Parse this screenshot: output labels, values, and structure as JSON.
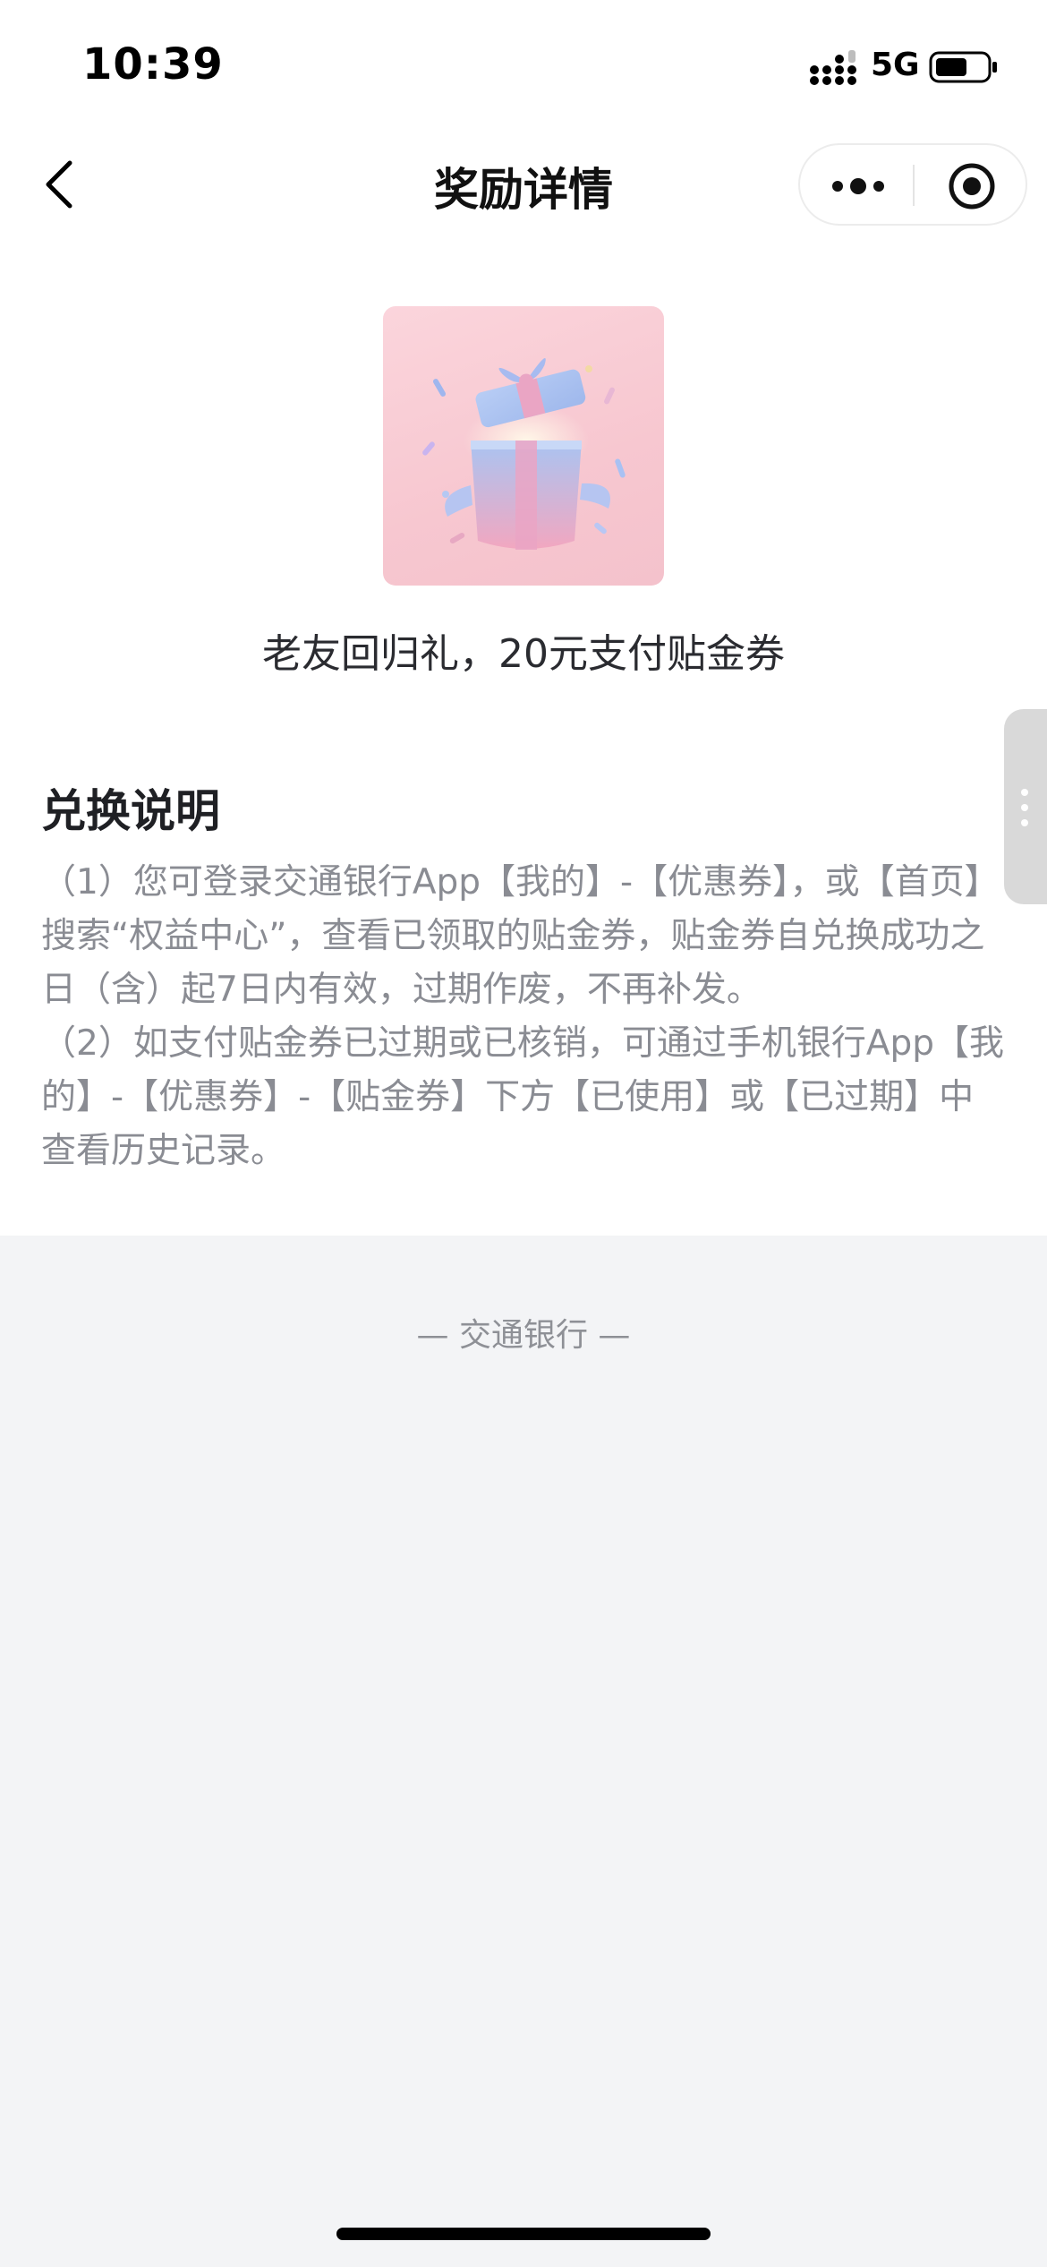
{
  "status_bar": {
    "time": "10:39",
    "network": "5G",
    "icons": [
      "signal-icon",
      "battery-icon"
    ]
  },
  "nav": {
    "title": "奖励详情",
    "icons": [
      "back-icon",
      "more-icon",
      "close-icon"
    ]
  },
  "reward": {
    "image_icon": "gift-box-icon",
    "name": "老友回归礼，20元支付贴金券"
  },
  "instructions": {
    "title": "兑换说明",
    "paragraphs": [
      "（1）您可登录交通银行App【我的】-【优惠券】，或【首页】搜索“权益中心”，查看已领取的贴金券，贴金券自兑换成功之日（含）起7日内有效，过期作废，不再补发。",
      "（2）如支付贴金券已过期或已核销，可通过手机银行App【我的】-【优惠券】-【贴金券】下方【已使用】或【已过期】中查看历史记录。"
    ]
  },
  "footer": {
    "brand": "— 交通银行 —"
  },
  "colors": {
    "page_background": "#f3f4f6",
    "card_background": "#ffffff",
    "body_text": "#8a8c93",
    "reward_image_bg": "#f7c7d0"
  }
}
